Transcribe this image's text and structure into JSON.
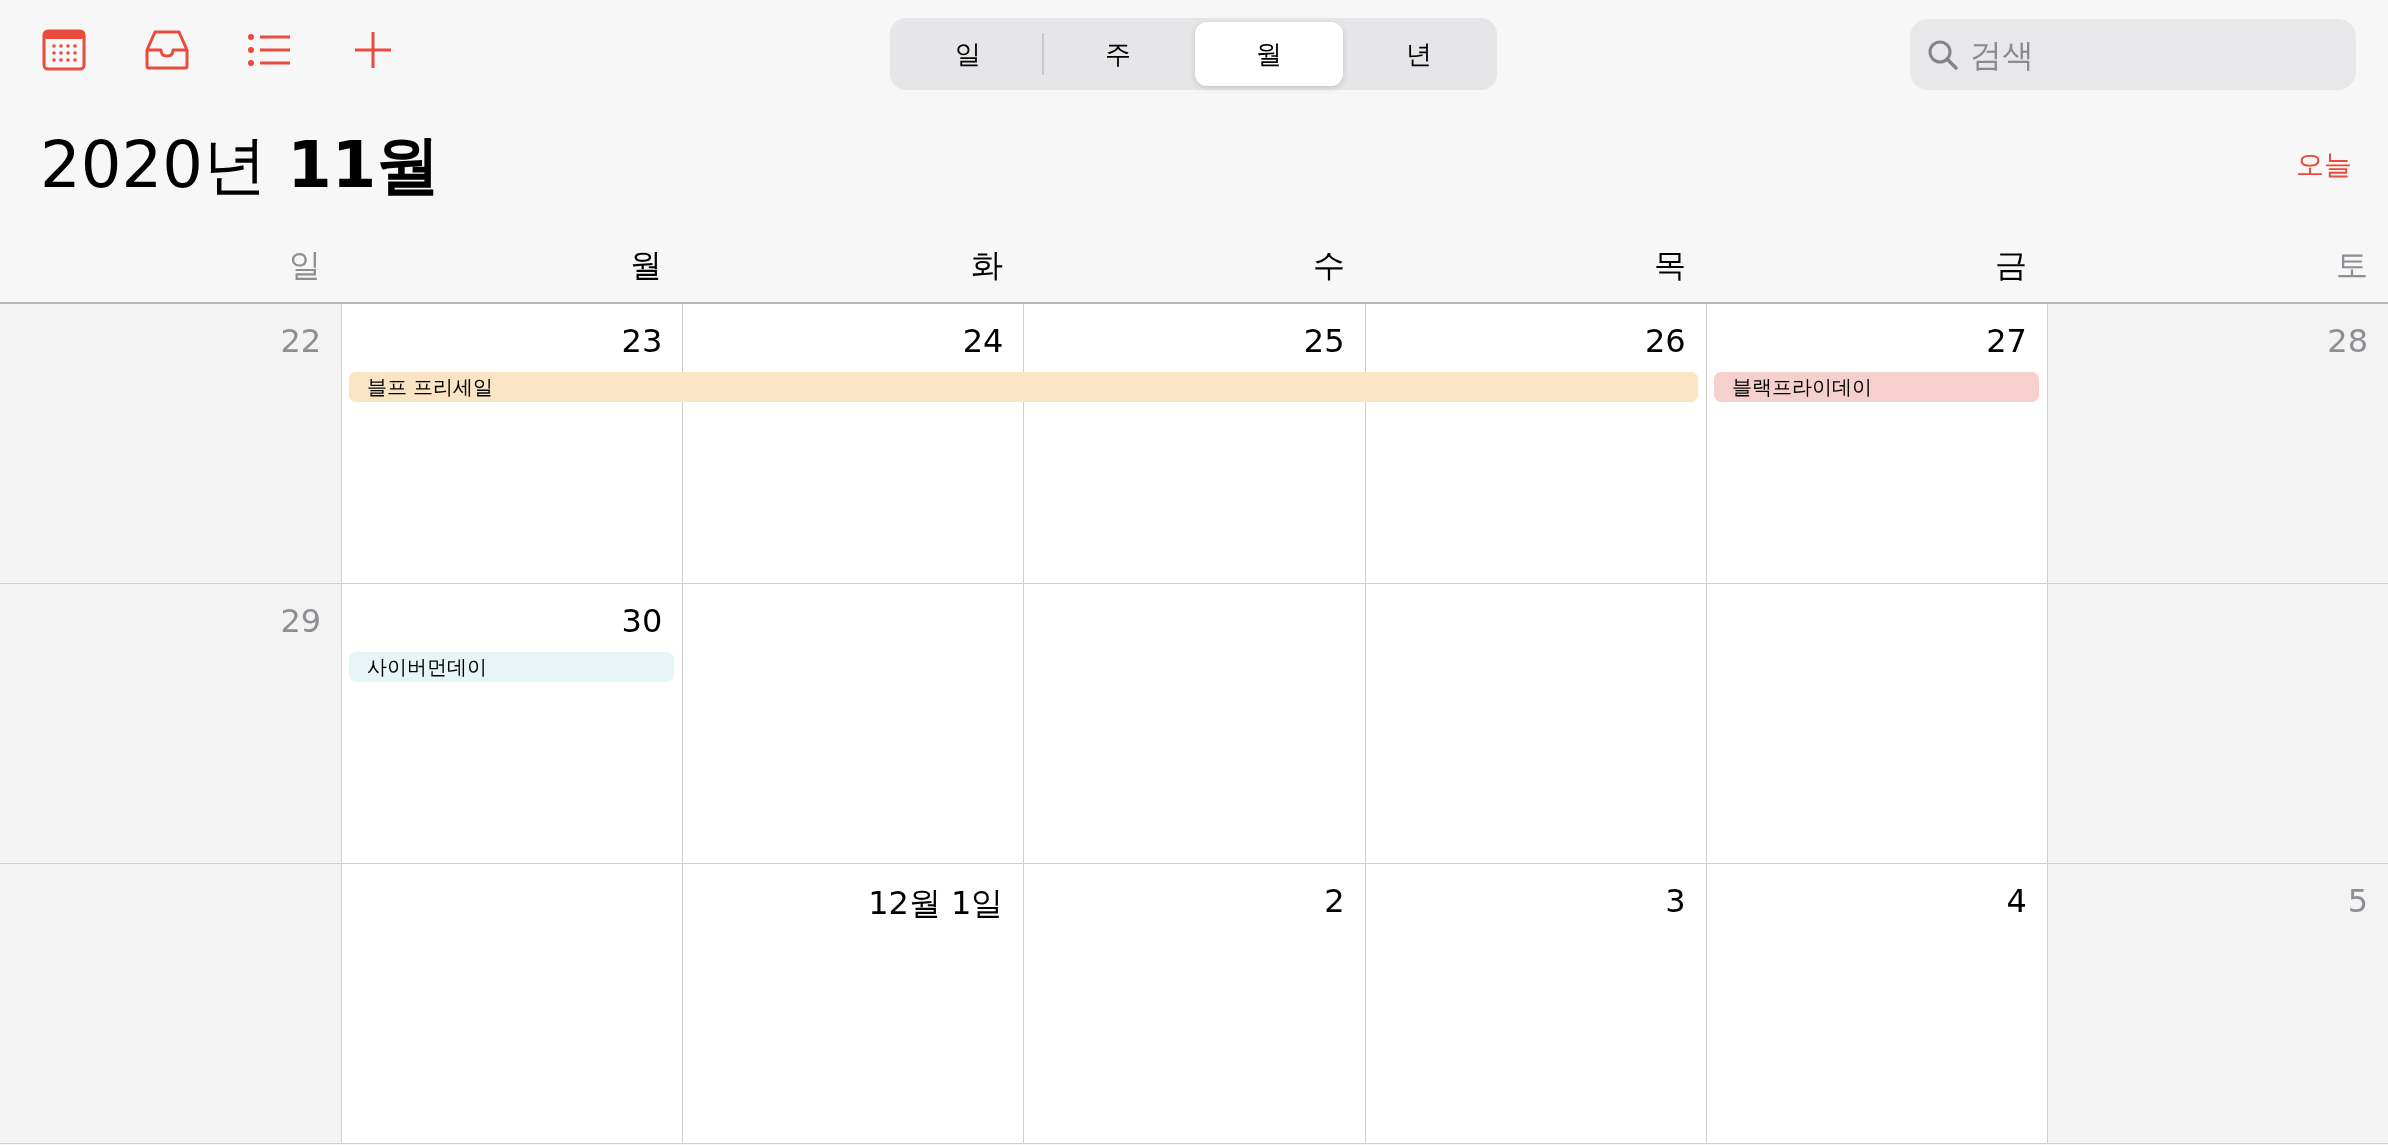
{
  "toolbar": {
    "views": [
      {
        "label": "일",
        "selected": false
      },
      {
        "label": "주",
        "selected": false
      },
      {
        "label": "월",
        "selected": true
      },
      {
        "label": "년",
        "selected": false
      }
    ],
    "search": {
      "placeholder": "검색"
    }
  },
  "header": {
    "year": "2020년",
    "month": "11월",
    "today_button": "오늘"
  },
  "weekdays": [
    {
      "label": "일",
      "weekend": true
    },
    {
      "label": "월",
      "weekend": false
    },
    {
      "label": "화",
      "weekend": false
    },
    {
      "label": "수",
      "weekend": false
    },
    {
      "label": "목",
      "weekend": false
    },
    {
      "label": "금",
      "weekend": false
    },
    {
      "label": "토",
      "weekend": true
    }
  ],
  "weeks": [
    {
      "cells": [
        {
          "date": "22"
        },
        {
          "date": "23"
        },
        {
          "date": "24"
        },
        {
          "date": "25"
        },
        {
          "date": "26"
        },
        {
          "date": "27"
        },
        {
          "date": "28"
        }
      ],
      "events": [
        {
          "title": "블프 프리세일",
          "color": "#f9e4c3",
          "covers": [
            false,
            true,
            true,
            true,
            true,
            false,
            false
          ]
        },
        {
          "title": "블랙프라이데이",
          "color": "#f6d0cc",
          "covers": [
            false,
            false,
            false,
            false,
            false,
            true,
            false
          ]
        }
      ]
    },
    {
      "cells": [
        {
          "date": "29"
        },
        {
          "date": "30"
        },
        {},
        {},
        {},
        {},
        {}
      ],
      "events": [
        {
          "title": "사이버먼데이",
          "color": "#e7f5f7",
          "covers": [
            false,
            true,
            false,
            false,
            false,
            false,
            false
          ]
        }
      ]
    },
    {
      "cells": [
        {},
        {},
        {
          "date": "12월 1일"
        },
        {
          "date": "2"
        },
        {
          "date": "3"
        },
        {
          "date": "4"
        },
        {
          "date": "5"
        }
      ]
    }
  ]
}
